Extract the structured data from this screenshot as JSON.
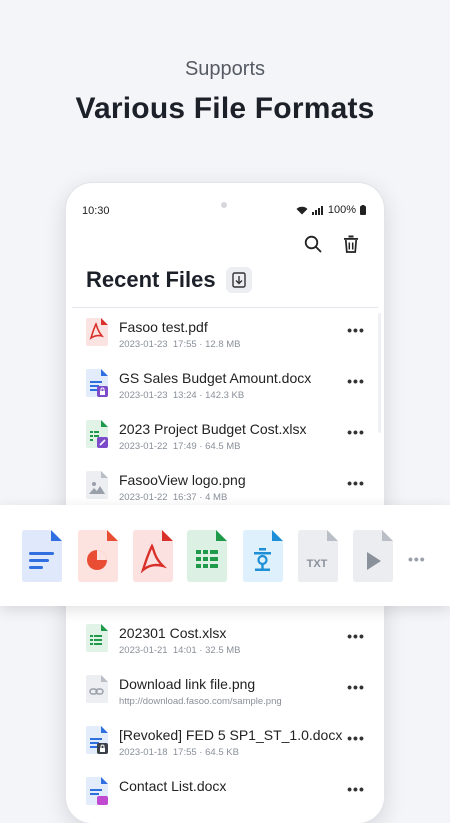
{
  "hero": {
    "subtitle": "Supports",
    "title": "Various File Formats"
  },
  "status_bar": {
    "time": "10:30",
    "battery": "100%"
  },
  "screen": {
    "title": "Recent Files"
  },
  "files": [
    {
      "name": "Fasoo test.pdf",
      "date": "2023-01-23",
      "time": "17:55",
      "size": "12.8 MB",
      "type": "pdf"
    },
    {
      "name": "GS Sales Budget Amount.docx",
      "date": "2023-01-23",
      "time": "13:24",
      "size": "142.3 KB",
      "type": "docx-lock"
    },
    {
      "name": "2023 Project Budget Cost.xlsx",
      "date": "2023-01-22",
      "time": "17:49",
      "size": "64.5 MB",
      "type": "xlsx-edit"
    },
    {
      "name": "FasooView logo.png",
      "date": "2023-01-22",
      "time": "16:37",
      "size": "4 MB",
      "type": "png"
    },
    {
      "name": "",
      "date": "",
      "time": "",
      "size": "",
      "type": "hidden"
    },
    {
      "name": "",
      "date": "",
      "time": "",
      "size": "",
      "type": "hidden"
    },
    {
      "name": "202301 Cost.xlsx",
      "date": "2023-01-21",
      "time": "14:01",
      "size": "32.5 MB",
      "type": "xlsx"
    },
    {
      "name": "Download link file.png",
      "url": "http://download.fasoo.com/sample.png",
      "type": "link"
    },
    {
      "name": "[Revoked] FED 5 SP1_ST_1.0.docx",
      "date": "2023-01-18",
      "time": "17:55",
      "size": "64.5 KB",
      "type": "docx-revoked"
    },
    {
      "name": "Contact List.docx",
      "date": "",
      "time": "",
      "size": "",
      "type": "docx-color"
    }
  ],
  "formats": [
    "docx",
    "pptx",
    "pdf",
    "xlsx",
    "hwp",
    "txt",
    "video"
  ],
  "format_labels": {
    "txt": "TXT"
  },
  "colors": {
    "word": "#2f6fe0",
    "ppt": "#e94e35",
    "pdf": "#d9302b",
    "excel": "#1e9a4a",
    "hwp": "#1e8fd6",
    "gray": "#9aa0aa",
    "lock": "#7c4bc9"
  }
}
